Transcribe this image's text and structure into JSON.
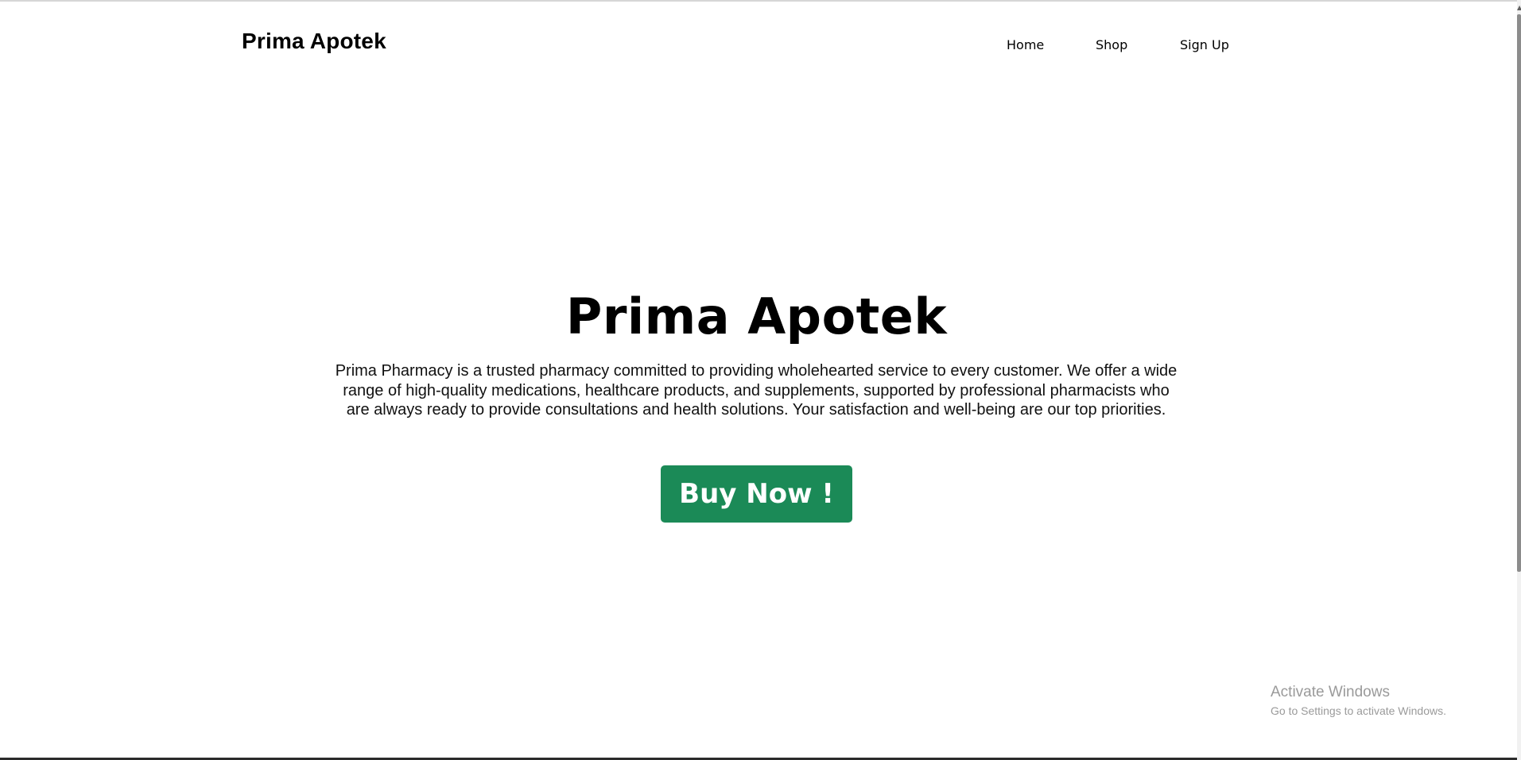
{
  "header": {
    "brand": "Prima Apotek",
    "nav": {
      "home": "Home",
      "shop": "Shop",
      "sign_up": "Sign Up"
    }
  },
  "hero": {
    "title": "Prima Apotek",
    "description": "Prima Pharmacy is a trusted pharmacy committed to providing wholehearted service to every customer. We offer a wide range of high-quality medications, healthcare products, and supplements, supported by professional pharmacists who are always ready to provide consultations and health solutions. Your satisfaction and well-being are our top priorities.",
    "cta_label": "Buy Now !"
  },
  "watermark": {
    "title": "Activate Windows",
    "subtitle": "Go to Settings to activate Windows."
  },
  "colors": {
    "cta_background": "#1b8a57",
    "text": "#000000",
    "watermark": "#9a9a9a"
  }
}
